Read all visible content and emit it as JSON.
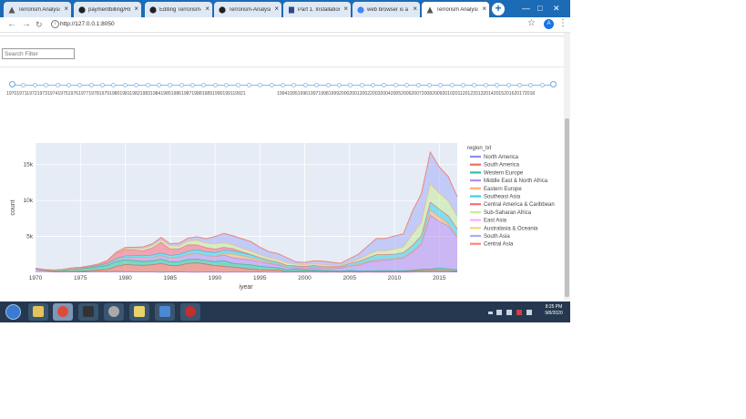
{
  "browser": {
    "tabs": [
      {
        "title": "Terrorism Analysis",
        "icon": "dash-icon",
        "active": false
      },
      {
        "title": "paymentbilling/README",
        "icon": "github-icon",
        "active": false
      },
      {
        "title": "Editing Terrorism-A",
        "icon": "github-icon",
        "active": false
      },
      {
        "title": "Terrorism-Analysis",
        "icon": "github-icon",
        "active": false
      },
      {
        "title": "Part 1. Installation",
        "icon": "doc-icon",
        "active": false
      },
      {
        "title": "web browser is a w",
        "icon": "google-icon",
        "active": false
      },
      {
        "title": "Terrorism Analysis",
        "icon": "dash-icon",
        "active": true
      }
    ],
    "new_tab_label": "+",
    "window_controls": {
      "minimize": "—",
      "maximize": "□",
      "close": "✕"
    },
    "url": "http://127.0.0.1:8050",
    "profile_initial": "A"
  },
  "page": {
    "search_placeholder": "Search Filter",
    "slider": {
      "marks_part1": "197019711972197319741975197619771978197919801981198219831984198519861987198819891990199119921",
      "marks_part2": "1994199519961997199819992000200120022003200420052006200720082009201020112012201320142015201620172018",
      "selected_range": [
        1970,
        2018
      ]
    }
  },
  "chart_data": {
    "type": "area",
    "stacked": true,
    "xlabel": "iyear",
    "ylabel": "count",
    "legend_title": "region_txt",
    "legend_position": "right",
    "xlim": [
      1970,
      2017
    ],
    "ylim": [
      0,
      18000
    ],
    "x_ticks": [
      1970,
      1975,
      1980,
      1985,
      1990,
      1995,
      2000,
      2005,
      2010,
      2015
    ],
    "y_ticks": [
      {
        "value": 5000,
        "label": "5k"
      },
      {
        "value": 10000,
        "label": "10k"
      },
      {
        "value": 15000,
        "label": "15k"
      }
    ],
    "x": [
      1970,
      1971,
      1972,
      1973,
      1974,
      1975,
      1976,
      1977,
      1978,
      1979,
      1980,
      1981,
      1982,
      1983,
      1984,
      1985,
      1986,
      1987,
      1988,
      1989,
      1990,
      1991,
      1992,
      1994,
      1995,
      1996,
      1997,
      1998,
      1999,
      2000,
      2001,
      2002,
      2003,
      2004,
      2005,
      2006,
      2007,
      2008,
      2009,
      2010,
      2011,
      2012,
      2013,
      2014,
      2015,
      2016,
      2017
    ],
    "series": [
      {
        "name": "North America",
        "color": "#8c8cf5",
        "values": [
          460,
          250,
          70,
          65,
          90,
          60,
          80,
          110,
          80,
          120,
          90,
          80,
          70,
          50,
          30,
          60,
          80,
          40,
          30,
          40,
          40,
          30,
          40,
          40,
          50,
          30,
          30,
          20,
          50,
          20,
          50,
          30,
          40,
          30,
          40,
          30,
          40,
          30,
          30,
          40,
          30,
          40,
          50,
          60,
          90,
          80,
          60
        ]
      },
      {
        "name": "South America",
        "color": "#ef6c5a",
        "values": [
          10,
          20,
          40,
          60,
          80,
          100,
          150,
          220,
          300,
          700,
          1000,
          950,
          900,
          1000,
          1200,
          900,
          900,
          1200,
          1300,
          1100,
          900,
          800,
          700,
          400,
          300,
          300,
          300,
          100,
          100,
          100,
          100,
          80,
          60,
          40,
          70,
          60,
          60,
          80,
          100,
          80,
          90,
          150,
          200,
          200,
          200,
          150,
          100
        ]
      },
      {
        "name": "Western Europe",
        "color": "#2bc29c",
        "values": [
          50,
          100,
          150,
          200,
          300,
          350,
          400,
          450,
          600,
          700,
          650,
          600,
          550,
          550,
          600,
          500,
          500,
          550,
          500,
          500,
          550,
          800,
          500,
          600,
          500,
          400,
          300,
          250,
          300,
          200,
          200,
          150,
          150,
          100,
          150,
          100,
          100,
          100,
          100,
          100,
          100,
          100,
          150,
          200,
          300,
          250,
          200
        ]
      },
      {
        "name": "Middle East & North Africa",
        "color": "#b48cf0",
        "values": [
          20,
          20,
          30,
          40,
          60,
          80,
          100,
          150,
          200,
          300,
          350,
          400,
          500,
          450,
          500,
          500,
          600,
          700,
          800,
          700,
          700,
          800,
          800,
          700,
          600,
          500,
          400,
          300,
          200,
          200,
          300,
          300,
          300,
          400,
          600,
          800,
          1200,
          1400,
          1500,
          1600,
          1800,
          2500,
          3500,
          7500,
          6500,
          6000,
          4500
        ]
      },
      {
        "name": "Eastern Europe",
        "color": "#ffb06b",
        "values": [
          0,
          0,
          0,
          0,
          0,
          0,
          0,
          0,
          0,
          0,
          0,
          0,
          0,
          0,
          0,
          0,
          0,
          0,
          0,
          10,
          50,
          200,
          500,
          300,
          250,
          150,
          100,
          100,
          100,
          100,
          100,
          100,
          100,
          100,
          100,
          100,
          100,
          150,
          150,
          100,
          100,
          150,
          200,
          700,
          600,
          300,
          200
        ]
      },
      {
        "name": "Southeast Asia",
        "color": "#33d1eb",
        "values": [
          10,
          10,
          20,
          20,
          30,
          40,
          50,
          50,
          100,
          150,
          200,
          300,
          300,
          350,
          350,
          400,
          400,
          450,
          500,
          500,
          500,
          450,
          450,
          400,
          350,
          300,
          300,
          200,
          150,
          200,
          200,
          150,
          150,
          150,
          300,
          400,
          500,
          700,
          600,
          600,
          600,
          800,
          1000,
          1100,
          1100,
          1100,
          1000
        ]
      },
      {
        "name": "Central America & Caribbean",
        "color": "#f76d7d",
        "values": [
          0,
          0,
          0,
          0,
          10,
          20,
          50,
          100,
          300,
          700,
          900,
          800,
          700,
          1000,
          1500,
          900,
          800,
          900,
          700,
          600,
          500,
          400,
          300,
          50,
          20,
          20,
          20,
          10,
          10,
          10,
          10,
          0,
          0,
          0,
          0,
          0,
          0,
          0,
          0,
          0,
          0,
          0,
          0,
          0,
          0,
          0,
          0
        ]
      },
      {
        "name": "Sub-Saharan Africa",
        "color": "#c7ec9d",
        "values": [
          10,
          10,
          20,
          20,
          30,
          40,
          50,
          50,
          50,
          100,
          150,
          200,
          300,
          300,
          300,
          400,
          400,
          500,
          600,
          600,
          700,
          600,
          500,
          400,
          350,
          300,
          300,
          300,
          200,
          200,
          200,
          200,
          150,
          100,
          100,
          300,
          400,
          500,
          500,
          700,
          800,
          1500,
          1800,
          2500,
          2200,
          2000,
          1700
        ]
      },
      {
        "name": "East Asia",
        "color": "#ffaaff",
        "values": [
          0,
          0,
          0,
          0,
          0,
          0,
          0,
          0,
          0,
          10,
          10,
          10,
          10,
          10,
          10,
          10,
          20,
          20,
          20,
          20,
          20,
          30,
          30,
          40,
          50,
          50,
          40,
          30,
          30,
          20,
          20,
          20,
          20,
          20,
          20,
          20,
          20,
          30,
          20,
          20,
          20,
          30,
          30,
          30,
          30,
          30,
          30
        ]
      },
      {
        "name": "Australasia & Oceania",
        "color": "#f9d66e",
        "values": [
          0,
          0,
          0,
          0,
          0,
          0,
          0,
          0,
          0,
          0,
          10,
          10,
          10,
          10,
          10,
          10,
          10,
          10,
          10,
          10,
          20,
          20,
          20,
          20,
          20,
          20,
          20,
          20,
          20,
          20,
          20,
          20,
          20,
          10,
          10,
          10,
          10,
          10,
          10,
          10,
          10,
          10,
          10,
          20,
          20,
          20,
          20
        ]
      },
      {
        "name": "South Asia",
        "color": "#a6aef7",
        "values": [
          0,
          0,
          0,
          0,
          10,
          10,
          10,
          20,
          30,
          50,
          100,
          150,
          200,
          250,
          350,
          300,
          350,
          400,
          500,
          600,
          1000,
          1300,
          1200,
          1300,
          1000,
          800,
          800,
          700,
          300,
          300,
          400,
          500,
          400,
          300,
          500,
          700,
          1200,
          1700,
          1700,
          1800,
          1800,
          3200,
          4000,
          4400,
          3600,
          3400,
          2700
        ]
      },
      {
        "name": "Central Asia",
        "color": "#f7856f",
        "values": [
          0,
          0,
          0,
          0,
          0,
          0,
          0,
          0,
          0,
          0,
          0,
          0,
          0,
          0,
          0,
          0,
          0,
          0,
          0,
          0,
          0,
          0,
          50,
          30,
          20,
          20,
          20,
          10,
          10,
          10,
          10,
          10,
          10,
          10,
          10,
          10,
          10,
          10,
          10,
          10,
          10,
          10,
          10,
          20,
          20,
          10,
          10
        ]
      }
    ]
  },
  "taskbar": {
    "time": "8:25 PM",
    "date": "9/8/2020",
    "apps": [
      "windows-explorer-icon",
      "chrome-icon",
      "terminal-icon",
      "disc-icon",
      "folder-icon",
      "notepad-icon",
      "settings-icon"
    ]
  }
}
